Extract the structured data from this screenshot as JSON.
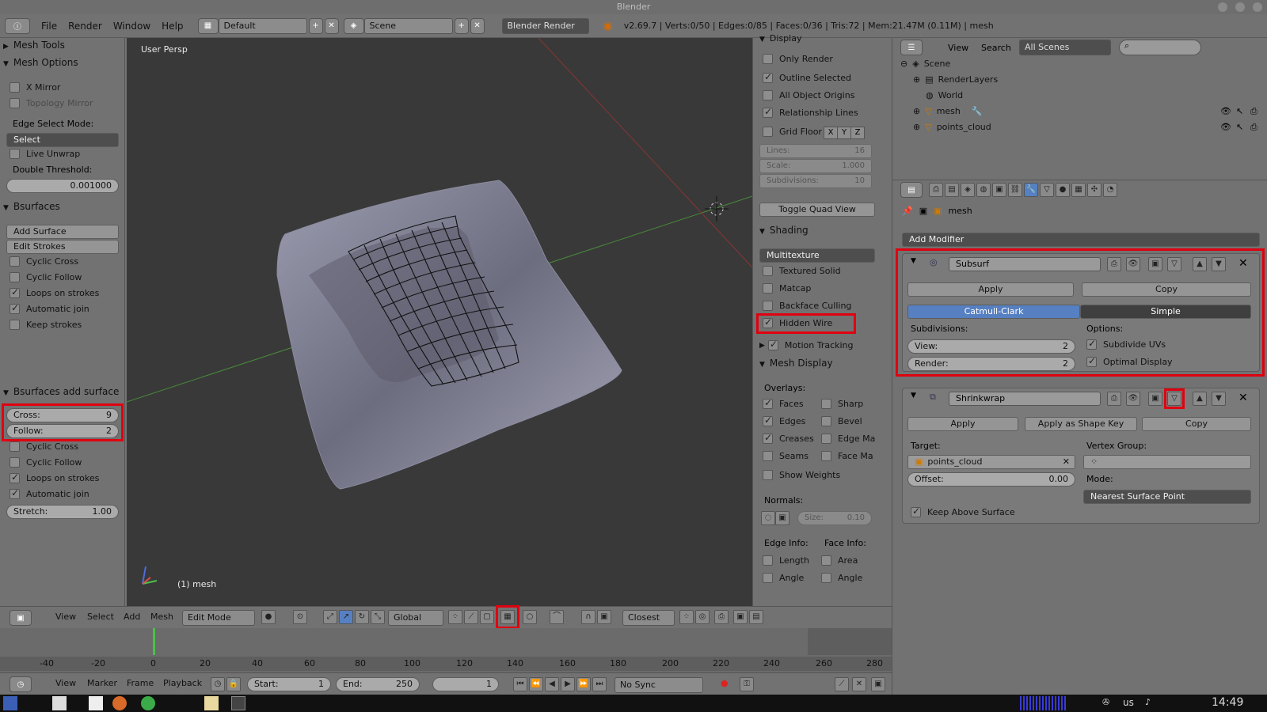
{
  "window": {
    "title": "Blender"
  },
  "menubar": {
    "menus": [
      "File",
      "Render",
      "Window",
      "Help"
    ],
    "layout": "Default",
    "scene": "Scene",
    "engine": "Blender Render",
    "stats": "v2.69.7 | Verts:0/50 | Edges:0/85 | Faces:0/36 | Tris:72 | Mem:21.47M (0.11M) | mesh"
  },
  "shelf": {
    "mesh_tools": "Mesh Tools",
    "mesh_options": "Mesh Options",
    "x_mirror": "X Mirror",
    "topology_mirror": "Topology Mirror",
    "edge_select_mode_label": "Edge Select Mode:",
    "edge_select_mode": "Select",
    "live_unwrap": "Live Unwrap",
    "double_threshold_label": "Double Threshold:",
    "double_threshold": "0.001000",
    "bsurfaces": "Bsurfaces",
    "add_surface": "Add Surface",
    "edit_strokes": "Edit Strokes",
    "cyclic_cross": "Cyclic Cross",
    "cyclic_follow": "Cyclic Follow",
    "loops_on_strokes": "Loops on strokes",
    "automatic_join": "Automatic join",
    "keep_strokes": "Keep strokes",
    "bsurfaces_add_surface": "Bsurfaces add surface",
    "cross_label": "Cross:",
    "cross_value": "9",
    "follow_label": "Follow:",
    "follow_value": "2",
    "cyclic_cross2": "Cyclic Cross",
    "cyclic_follow2": "Cyclic Follow",
    "loops_on_strokes2": "Loops on strokes",
    "automatic_join2": "Automatic join",
    "stretch_label": "Stretch:",
    "stretch_value": "1.00"
  },
  "viewport": {
    "view_name": "User Persp",
    "object_label": "(1) mesh"
  },
  "npanel": {
    "display": "Display",
    "only_render": "Only Render",
    "outline_selected": "Outline Selected",
    "all_object_origins": "All Object Origins",
    "relationship_lines": "Relationship Lines",
    "grid_floor": "Grid Floor",
    "axes": [
      "X",
      "Y",
      "Z"
    ],
    "lines_label": "Lines:",
    "lines_value": "16",
    "scale_label": "Scale:",
    "scale_value": "1.000",
    "subdiv_label": "Subdivisions:",
    "subdiv_value": "10",
    "toggle_quad_view": "Toggle Quad View",
    "shading": "Shading",
    "shading_mode": "Multitexture",
    "textured_solid": "Textured Solid",
    "matcap": "Matcap",
    "backface_culling": "Backface Culling",
    "hidden_wire": "Hidden Wire",
    "motion_tracking": "Motion Tracking",
    "mesh_display": "Mesh Display",
    "overlays": "Overlays:",
    "faces": "Faces",
    "sharp": "Sharp",
    "edges": "Edges",
    "bevel": "Bevel",
    "creases": "Creases",
    "edge_ma": "Edge Ma",
    "seams": "Seams",
    "face_ma": "Face Ma",
    "show_weights": "Show Weights",
    "normals": "Normals:",
    "size_label": "Size:",
    "size_value": "0.10",
    "edge_info": "Edge Info:",
    "face_info": "Face Info:",
    "length": "Length",
    "area": "Area",
    "angle": "Angle",
    "angle2": "Angle"
  },
  "outliner": {
    "view": "View",
    "search": "Search",
    "filter": "All Scenes",
    "scene": "Scene",
    "render_layers": "RenderLayers",
    "world": "World",
    "mesh": "mesh",
    "points_cloud": "points_cloud"
  },
  "props": {
    "breadcrumb": "mesh",
    "add_modifier": "Add Modifier",
    "subsurf": {
      "name": "Subsurf",
      "apply": "Apply",
      "copy": "Copy",
      "catmull": "Catmull-Clark",
      "simple": "Simple",
      "subdivisions": "Subdivisions:",
      "options": "Options:",
      "view_label": "View:",
      "view_value": "2",
      "render_label": "Render:",
      "render_value": "2",
      "subdivide_uvs": "Subdivide UVs",
      "optimal_display": "Optimal Display"
    },
    "shrinkwrap": {
      "name": "Shrinkwrap",
      "apply": "Apply",
      "apply_shape": "Apply as Shape Key",
      "copy": "Copy",
      "target_label": "Target:",
      "target": "points_cloud",
      "vgroup_label": "Vertex Group:",
      "offset_label": "Offset:",
      "offset_value": "0.00",
      "mode_label": "Mode:",
      "mode": "Nearest Surface Point",
      "keep_above": "Keep Above Surface"
    }
  },
  "vp_header": {
    "view": "View",
    "select": "Select",
    "add": "Add",
    "mesh": "Mesh",
    "mode": "Edit Mode",
    "orientation": "Global",
    "snap_target": "Closest"
  },
  "timeline": {
    "ticks": [
      "-40",
      "-20",
      "0",
      "20",
      "40",
      "60",
      "80",
      "100",
      "120",
      "140",
      "160",
      "180",
      "200",
      "220",
      "240",
      "260",
      "280"
    ],
    "view": "View",
    "marker": "Marker",
    "frame": "Frame",
    "playback": "Playback",
    "start_label": "Start:",
    "start_value": "1",
    "end_label": "End:",
    "end_value": "250",
    "current": "1",
    "sync": "No Sync"
  },
  "taskbar": {
    "lang": "us",
    "clock": "14:49"
  }
}
